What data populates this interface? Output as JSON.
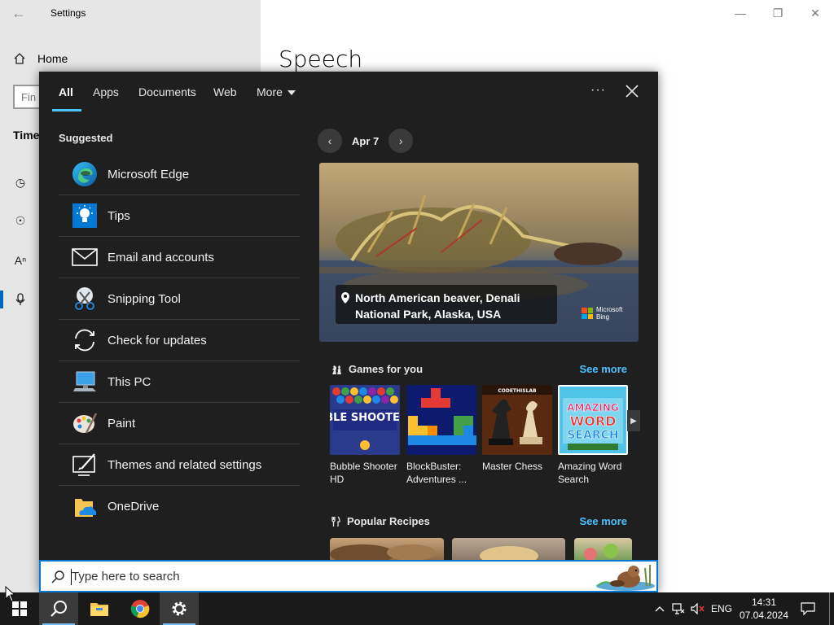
{
  "settings": {
    "title": "Settings",
    "home": "Home",
    "find_placeholder": "Fin",
    "time_section": "Time",
    "page_heading": "Speech"
  },
  "search_panel": {
    "tabs": [
      {
        "label": "All",
        "active": true
      },
      {
        "label": "Apps"
      },
      {
        "label": "Documents"
      },
      {
        "label": "Web"
      },
      {
        "label": "More"
      }
    ],
    "more_options": "···",
    "suggested_label": "Suggested",
    "suggested": [
      {
        "label": "Microsoft Edge",
        "icon": "edge-icon"
      },
      {
        "label": "Tips",
        "icon": "tips-icon"
      },
      {
        "label": "Email and accounts",
        "icon": "mail-icon"
      },
      {
        "label": "Snipping Tool",
        "icon": "scissors-icon"
      },
      {
        "label": "Check for updates",
        "icon": "refresh-icon"
      },
      {
        "label": "This PC",
        "icon": "computer-icon"
      },
      {
        "label": "Paint",
        "icon": "palette-icon"
      },
      {
        "label": "Themes and related settings",
        "icon": "themes-icon"
      },
      {
        "label": "OneDrive",
        "icon": "onedrive-icon"
      }
    ],
    "date": "Apr 7",
    "hero_caption": "North American beaver, Denali National Park, Alaska, USA",
    "bing_logo": "Microsoft Bing",
    "games": {
      "title": "Games for you",
      "see_more": "See more",
      "items": [
        {
          "name": "Bubble Shooter HD",
          "thumb_text": "BUBBLE SHOOTER HD"
        },
        {
          "name": "BlockBuster: Adventures ..."
        },
        {
          "name": "Master Chess",
          "thumb_text": "CODETHISLAB"
        },
        {
          "name": "Amazing Word Search",
          "thumb_text": "AMAZING WORD SEARCH"
        }
      ]
    },
    "recipes": {
      "title": "Popular Recipes",
      "see_more": "See more"
    }
  },
  "searchbar": {
    "placeholder": "Type here to search"
  },
  "taskbar": {
    "language": "ENG",
    "time": "14:31",
    "date": "07.04.2024"
  },
  "colors": {
    "accent": "#0078d4",
    "link": "#4cc2ff",
    "panel_bg": "#1f1f1f",
    "taskbar_bg": "#1a1a1a"
  }
}
